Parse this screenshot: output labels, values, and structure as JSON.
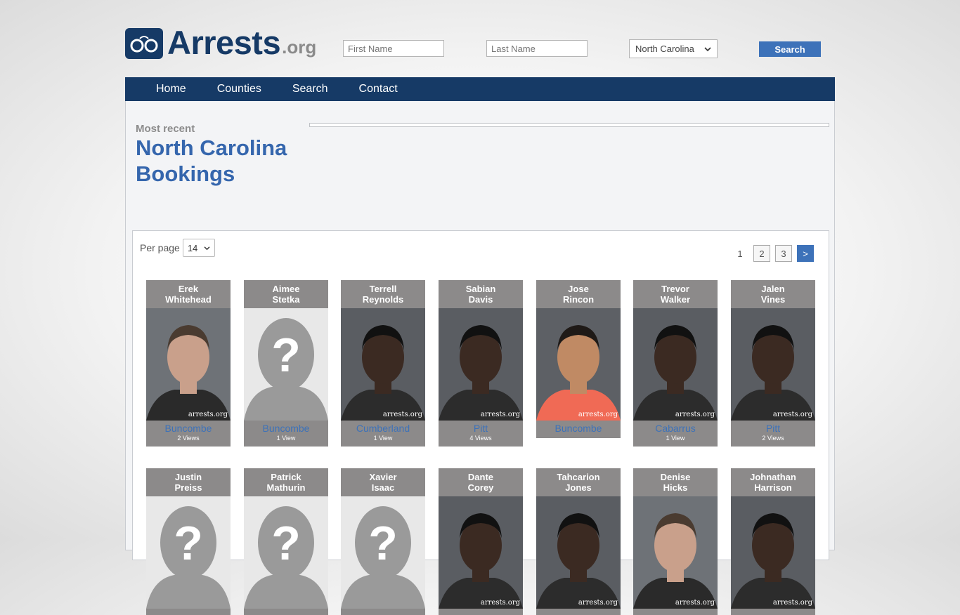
{
  "header": {
    "logo_main": "Arrests",
    "logo_ext": ".org",
    "first_name_placeholder": "First Name",
    "last_name_placeholder": "Last Name",
    "state_selected": "North Carolina",
    "search_label": "Search"
  },
  "nav": [
    "Home",
    "Counties",
    "Search",
    "Contact"
  ],
  "page": {
    "subtitle": "Most recent",
    "title_line1": "North Carolina",
    "title_line2": "Bookings"
  },
  "controls": {
    "per_page_label": "Per page",
    "per_page_value": "14",
    "pages": [
      "1",
      "2",
      "3",
      ">"
    ]
  },
  "watermark": "arrests.org",
  "cards": [
    {
      "first": "Erek",
      "last": "Whitehead",
      "county": "Buncombe",
      "views": "2 Views",
      "photo": "photo-light"
    },
    {
      "first": "Aimee",
      "last": "Stetka",
      "county": "Buncombe",
      "views": "1 View",
      "photo": "placeholder"
    },
    {
      "first": "Terrell",
      "last": "Reynolds",
      "county": "Cumberland",
      "views": "1 View",
      "photo": "photo-dark"
    },
    {
      "first": "Sabian",
      "last": "Davis",
      "county": "Pitt",
      "views": "4 Views",
      "photo": "photo-dark"
    },
    {
      "first": "Jose",
      "last": "Rincon",
      "county": "Buncombe",
      "views": "",
      "photo": "photo-medium"
    },
    {
      "first": "Trevor",
      "last": "Walker",
      "county": "Cabarrus",
      "views": "1 View",
      "photo": "photo-dark"
    },
    {
      "first": "Jalen",
      "last": "Vines",
      "county": "Pitt",
      "views": "2 Views",
      "photo": "photo-dark"
    },
    {
      "first": "Justin",
      "last": "Preiss",
      "county": "",
      "views": "",
      "photo": "placeholder"
    },
    {
      "first": "Patrick",
      "last": "Mathurin",
      "county": "",
      "views": "",
      "photo": "placeholder"
    },
    {
      "first": "Xavier",
      "last": "Isaac",
      "county": "",
      "views": "",
      "photo": "placeholder"
    },
    {
      "first": "Dante",
      "last": "Corey",
      "county": "",
      "views": "",
      "photo": "photo-dark"
    },
    {
      "first": "Tahcarion",
      "last": "Jones",
      "county": "",
      "views": "",
      "photo": "photo-dark"
    },
    {
      "first": "Denise",
      "last": "Hicks",
      "county": "",
      "views": "",
      "photo": "photo-light"
    },
    {
      "first": "Johnathan",
      "last": "Harrison",
      "county": "",
      "views": "",
      "photo": "photo-dark"
    }
  ]
}
